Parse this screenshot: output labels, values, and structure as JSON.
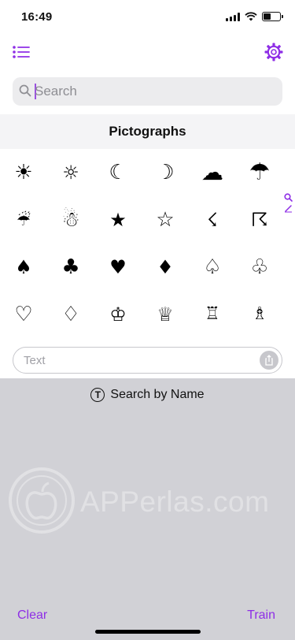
{
  "status_bar": {
    "time": "16:49",
    "battery_level": 0.45
  },
  "nav": {
    "list_icon": "list-icon",
    "settings_icon": "gear-icon",
    "accent": "#8e2ee6"
  },
  "search": {
    "placeholder": "Search",
    "value": ""
  },
  "section": {
    "title": "Pictographs"
  },
  "symbols": [
    [
      "☀",
      "☼",
      "☾",
      "☽",
      "☁",
      "☂"
    ],
    [
      "☔",
      "☃",
      "★",
      "☆",
      "☇",
      "☈"
    ],
    [
      "♠",
      "♣",
      "♥",
      "♦",
      "♤",
      "♧"
    ],
    [
      "♡",
      "♢",
      "♔",
      "♕",
      "♖",
      "♗"
    ]
  ],
  "side_index": [
    "search-icon",
    "edit-icon"
  ],
  "text_input": {
    "placeholder": "Text",
    "value": ""
  },
  "mode": {
    "label": "Search by Name",
    "icon": "T"
  },
  "watermark": {
    "text": "APPerlas.com"
  },
  "actions": {
    "clear": "Clear",
    "train": "Train"
  }
}
